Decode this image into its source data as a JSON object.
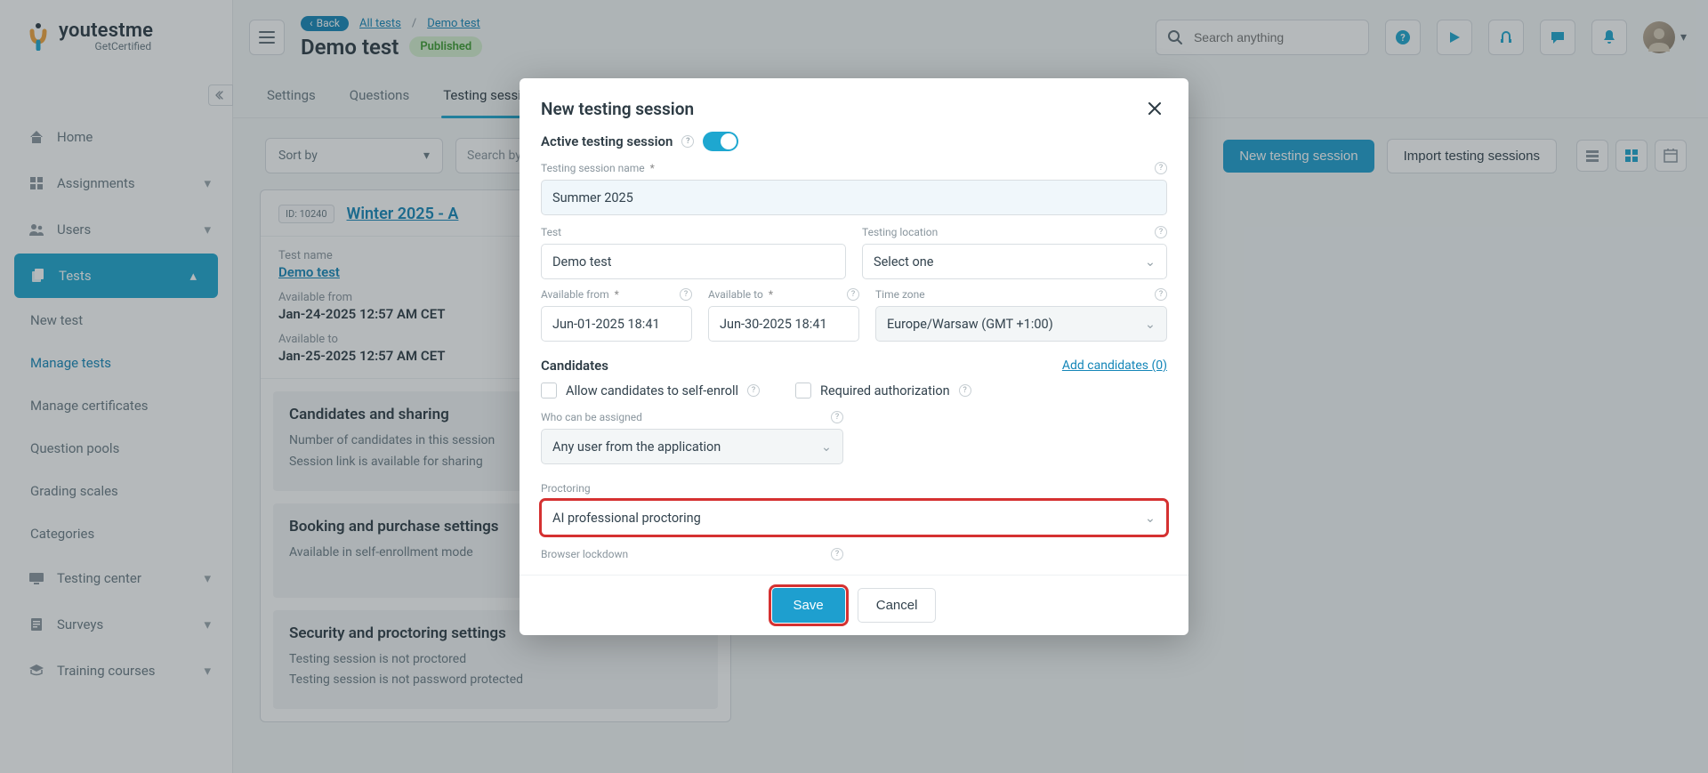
{
  "sidebar": {
    "brand_main": "youtestme",
    "brand_sub": "GetCertified",
    "items": [
      {
        "label": "Home",
        "expandable": false
      },
      {
        "label": "Assignments",
        "expandable": true
      },
      {
        "label": "Users",
        "expandable": true
      },
      {
        "label": "Tests",
        "expandable": true,
        "active": true
      },
      {
        "label": "Testing center",
        "expandable": true
      },
      {
        "label": "Surveys",
        "expandable": true
      },
      {
        "label": "Training courses",
        "expandable": true
      }
    ],
    "tests_sub": [
      {
        "label": "New test"
      },
      {
        "label": "Manage tests",
        "current": true
      },
      {
        "label": "Manage certificates"
      },
      {
        "label": "Question pools"
      },
      {
        "label": "Grading scales"
      },
      {
        "label": "Categories"
      }
    ]
  },
  "header": {
    "back": "Back",
    "crumbs": [
      "All tests",
      "Demo test"
    ],
    "title": "Demo test",
    "status": "Published",
    "search_placeholder": "Search anything"
  },
  "tabs": [
    "Settings",
    "Questions",
    "Testing sessions"
  ],
  "toolbar": {
    "sort": "Sort by",
    "search_placeholder": "Search by testing",
    "new_session": "New testing session",
    "import": "Import testing sessions"
  },
  "session_card": {
    "id_label": "ID: 10240",
    "title": "Winter 2025 - A",
    "rows": [
      {
        "label": "Test name",
        "value": "Demo test",
        "link": true
      },
      {
        "label": "Available from",
        "value": "Jan-24-2025 12:57 AM CET"
      },
      {
        "label": "Available to",
        "value": "Jan-25-2025 12:57 AM CET"
      }
    ],
    "blocks": [
      {
        "title": "Candidates and sharing",
        "lines": [
          "Number of candidates in this session",
          "Session link is available for sharing"
        ]
      },
      {
        "title": "Booking and purchase settings",
        "lines": [
          "Available in self-enrollment mode"
        ]
      },
      {
        "title": "Security and proctoring settings",
        "lines": [
          "Testing session is not proctored",
          "Testing session is not password protected"
        ]
      }
    ]
  },
  "modal": {
    "title": "New testing session",
    "active_label": "Active testing session",
    "fields": {
      "name_label": "Testing session name",
      "name_value": "Summer 2025",
      "test_label": "Test",
      "test_value": "Demo test",
      "location_label": "Testing location",
      "location_value": "Select one",
      "from_label": "Available from",
      "from_value": "Jun-01-2025 18:41",
      "to_label": "Available to",
      "to_value": "Jun-30-2025 18:41",
      "tz_label": "Time zone",
      "tz_value": "Europe/Warsaw (GMT +1:00)"
    },
    "cand": {
      "heading": "Candidates",
      "add_link": "Add candidates (0)",
      "self_enroll": "Allow candidates to self-enroll",
      "auth": "Required authorization",
      "assign_label": "Who can be assigned",
      "assign_value": "Any user from the application"
    },
    "proctoring": {
      "label": "Proctoring",
      "value": "AI professional proctoring"
    },
    "lockdown": {
      "label": "Browser lockdown"
    },
    "buttons": {
      "save": "Save",
      "cancel": "Cancel"
    }
  }
}
